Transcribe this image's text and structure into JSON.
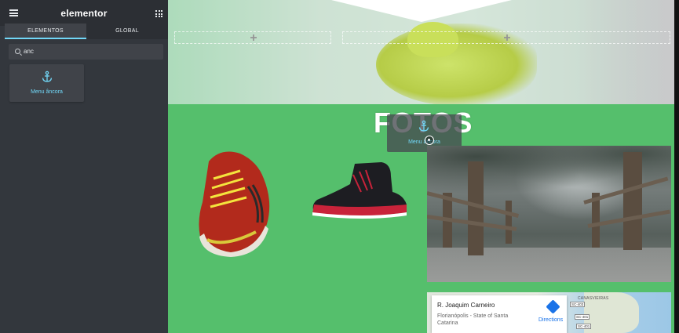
{
  "topbar": {
    "brand": "elementor",
    "menu_icon": "hamburger-icon",
    "apps_icon": "grid-icon"
  },
  "tabs": [
    {
      "label": "ELEMENTOS",
      "active": true
    },
    {
      "label": "GLOBAL",
      "active": false
    }
  ],
  "search": {
    "value": "anc",
    "icon": "search-icon"
  },
  "widgets": [
    {
      "label": "Menu âncora",
      "icon": "anchor-icon"
    }
  ],
  "canvas": {
    "section_title": "FOTOS",
    "dragged_widget_label": "Menu âncora",
    "map": {
      "place_name": "R. Joaquim Carneiro",
      "address": "Florianópolis - State of Santa Catarina",
      "directions_label": "Directions",
      "area_label": "CANASVIEIRAS",
      "road_tags": [
        "SC-403",
        "SC-401",
        "SC-401"
      ]
    }
  },
  "colors": {
    "accent": "#71d7f7",
    "sidebar_bg": "#33373d",
    "canvas_green": "#55bf6c"
  }
}
